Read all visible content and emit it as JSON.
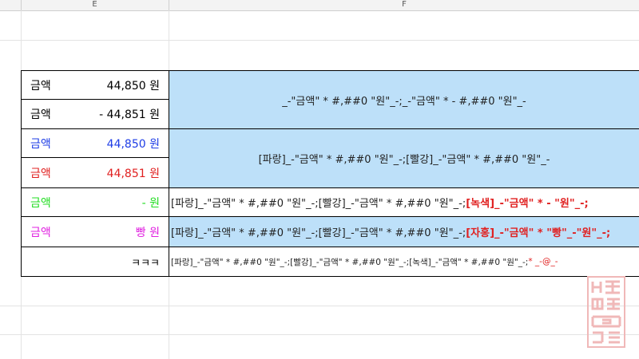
{
  "columns": {
    "e": "E",
    "f": "F"
  },
  "rows": [
    {
      "label": "금액",
      "amount": "44,850 원",
      "color": "#222222"
    },
    {
      "label": "금액",
      "amount": "- 44,851 원",
      "color": "#222222"
    },
    {
      "label": "금액",
      "amount": "44,850 원",
      "color": "#1e3de6"
    },
    {
      "label": "금액",
      "amount": "44,851 원",
      "color": "#e02020"
    },
    {
      "label": "금액",
      "amount": "- 원",
      "color": "#22dd22"
    },
    {
      "label": "금액",
      "amount": "빵 원",
      "color": "#e020e0"
    },
    {
      "label": "",
      "amount": "ㅋㅋㅋ",
      "color": "#222222"
    }
  ],
  "formats": {
    "format1": "_-\"금액\" * #,##0 \"원\"_-;_-\"금액\" * - #,##0 \"원\"_-",
    "format2": "[파랑]_-\"금액\" * #,##0 \"원\"_-;[빨강]_-\"금액\" * #,##0 \"원\"_-",
    "format3_normal": "[파랑]_-\"금액\" * #,##0 \"원\"_-;[빨강]_-\"금액\" * #,##0 \"원\"_-;",
    "format3_highlight": "[녹색]_-\"금액\" * - \"원\"_-;",
    "format4_normal": "[파랑]_-\"금액\" * #,##0 \"원\"_-;[빨강]_-\"금액\" * #,##0 \"원\"_-;",
    "format4_highlight": "[자홍]_-\"금액\" * \"빵\"_-\"원\"_-;",
    "format5_normal": "[파랑]_-\"금액\" * #,##0 \"원\"_-;[빨강]_-\"금액\" * #,##0 \"원\"_-;[녹색]_-\"금액\" * #,##0 \"원\"_-;",
    "format5_highlight": "* _-@_-"
  },
  "colors": {
    "fill": "#bde0f9",
    "blue": "#1e3de6",
    "red": "#e02020",
    "green": "#22dd22",
    "magenta": "#e020e0"
  }
}
